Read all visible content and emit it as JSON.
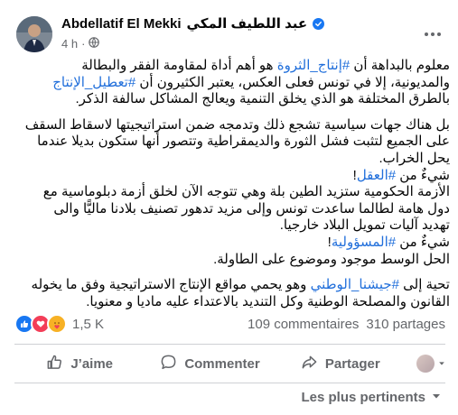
{
  "post": {
    "author_latin": "Abdellatif El Mekki",
    "author_arabic": "عبد اللطيف المكي",
    "time": "4 h",
    "lines": [
      [
        {
          "t": "معلوم بالبداهة أن "
        },
        {
          "t": "#إنتاج_الثروة",
          "h": true
        },
        {
          "t": " هو أهم أداة لمقاومة الفقر والبطالة"
        }
      ],
      [
        {
          "t": "والمديونية، إلا في تونس فعلى العكس، يعتبر الكثيرون أن "
        },
        {
          "t": "#تعطيل_الإنتاج",
          "h": true
        }
      ],
      [
        {
          "t": "بالطرق المختلفة هو الذي يخلق التنمية ويعالج المشاكل سالفة الذكر."
        }
      ],
      [
        {
          "t": "بل هناك جهات سياسية تشجع ذلك وتدمجه ضمن استراتيجيتها لاسقاط السقف"
        }
      ],
      [
        {
          "t": "على الجميع لتثبت فشل الثورة والديمقراطية وتتصور أنها ستكون بديلا عندما"
        }
      ],
      [
        {
          "t": "يحل الخراب."
        }
      ],
      [
        {
          "t": "شيءٌ من "
        },
        {
          "t": "#العقل",
          "h": true
        },
        {
          "t": "!"
        }
      ],
      [
        {
          "t": "الأزمة الحكومية ستزيد الطين بلة وهي تتوجه الآن لخلق أزمة دبلوماسية مع"
        }
      ],
      [
        {
          "t": "دول هامة لطالما ساعدت تونس وإلى مزيد تدهور تصنيف بلادنا ماليًّا والى"
        }
      ],
      [
        {
          "t": "تهديد آليات تمويل البلاد خارجيا."
        }
      ],
      [
        {
          "t": "شيءٌ من "
        },
        {
          "t": "#المسؤولية",
          "h": true
        },
        {
          "t": "!"
        }
      ],
      [
        {
          "t": "الحل الوسط موجود وموضوع على الطاولة."
        }
      ],
      [
        {
          "t": "تحية إلى "
        },
        {
          "t": "#جيشنا_الوطني",
          "h": true
        },
        {
          "t": " وهو يحمي مواقع الإنتاج الاستراتيجية وفق ما يخوله"
        }
      ],
      [
        {
          "t": "القانون والمصلحة الوطنية وكل التنديد بالاعتداء عليه ماديا و معنويا."
        }
      ]
    ]
  },
  "reactions": {
    "count": "1,5 K",
    "comments": "109 commentaires",
    "shares": "310 partages"
  },
  "actions": {
    "like": "J’aime",
    "comment": "Commenter",
    "share": "Partager"
  },
  "sort": {
    "label": "Les plus pertinents"
  },
  "colors": {
    "hashtag": "#216fdb",
    "brand_blue": "#1877f2",
    "secondary_text": "#65676b"
  },
  "icons": [
    "avatar",
    "verified-icon",
    "globe-icon",
    "more-icon",
    "like-reaction-icon",
    "love-reaction-icon",
    "care-reaction-icon",
    "like-icon",
    "comment-icon",
    "share-icon",
    "chevron-down-icon"
  ]
}
